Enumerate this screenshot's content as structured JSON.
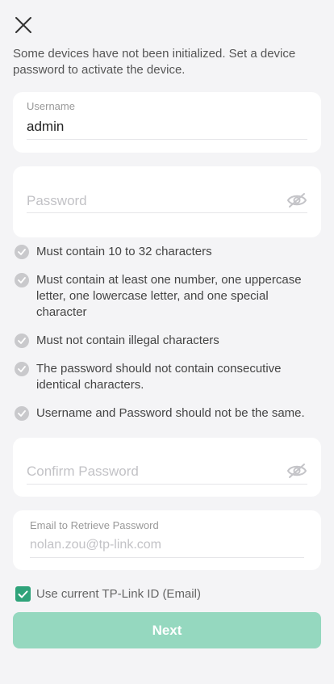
{
  "header": {
    "close_icon": "close-icon",
    "intro_text": "Some devices have not been initialized. Set a device password to activate the device."
  },
  "username": {
    "label": "Username",
    "value": "admin"
  },
  "password": {
    "placeholder": "Password",
    "visibility_icon": "eye-slash-icon"
  },
  "rules": [
    {
      "text": "Must contain 10 to 32 characters",
      "icon": "check-circle-icon"
    },
    {
      "text": "Must contain at least one number, one uppercase letter, one lowercase letter, and one special character",
      "icon": "check-circle-icon"
    },
    {
      "text": "Must not contain illegal characters",
      "icon": "check-circle-icon"
    },
    {
      "text": "The password should not contain consecutive identical characters.",
      "icon": "check-circle-icon"
    },
    {
      "text": "Username and Password should not be the same.",
      "icon": "check-circle-icon"
    }
  ],
  "confirm_password": {
    "placeholder": "Confirm Password",
    "visibility_icon": "eye-slash-icon"
  },
  "email": {
    "label": "Email to Retrieve Password",
    "placeholder": "nolan.zou@tp-link.com"
  },
  "use_current_id": {
    "label": "Use current TP-Link ID (Email)",
    "checked": true
  },
  "next_button": {
    "label": "Next"
  },
  "colors": {
    "accent": "#2fa37a",
    "button_disabled": "#95d8bf",
    "background": "#f4f4f6",
    "rule_icon": "#c9c9cc"
  }
}
